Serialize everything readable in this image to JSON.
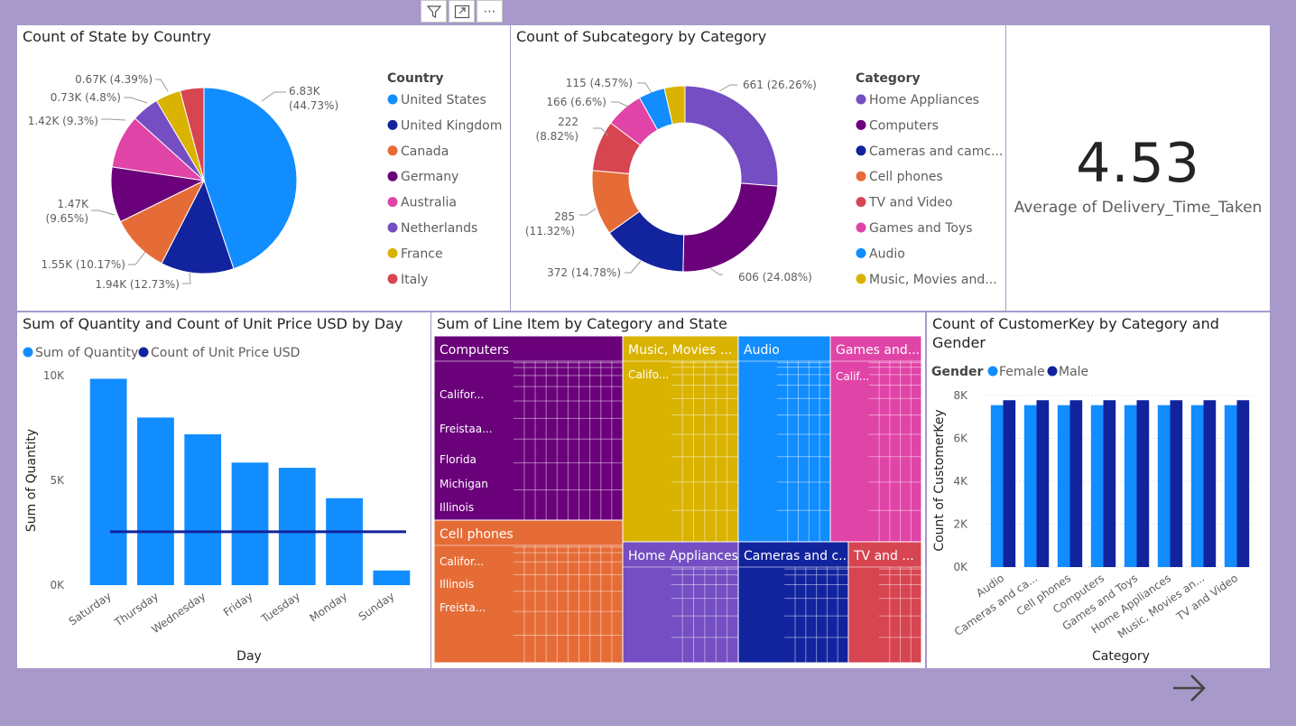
{
  "toolbar": {
    "icons": [
      "filter-icon",
      "focus-mode-icon",
      "more-options-icon"
    ],
    "more_label": "⋯"
  },
  "pie_country": {
    "title": "Count of State by Country",
    "legend_title": "Country",
    "chart_data": {
      "type": "pie",
      "title": "Count of State by Country",
      "slices": [
        {
          "label": "United States",
          "value": 6830,
          "display": "6.83K",
          "pct": "44.73%",
          "color": "#118dff"
        },
        {
          "label": "United Kingdom",
          "value": 1940,
          "display": "1.94K",
          "pct": "12.73%",
          "color": "#12239e"
        },
        {
          "label": "Canada",
          "value": 1550,
          "display": "1.55K",
          "pct": "10.17%",
          "color": "#e66c37"
        },
        {
          "label": "Germany",
          "value": 1470,
          "display": "1.47K",
          "pct": "9.65%",
          "color": "#6b007b"
        },
        {
          "label": "Australia",
          "value": 1420,
          "display": "1.42K",
          "pct": "9.3%",
          "color": "#e044a7"
        },
        {
          "label": "Netherlands",
          "value": 730,
          "display": "0.73K",
          "pct": "4.8%",
          "color": "#744ec2"
        },
        {
          "label": "France",
          "value": 670,
          "display": "0.67K",
          "pct": "4.39%",
          "color": "#d9b300"
        },
        {
          "label": "Italy",
          "value": 630,
          "display": "",
          "pct": "",
          "color": "#d64550"
        }
      ]
    }
  },
  "donut_category": {
    "title": "Count of Subcategory by Category",
    "legend_title": "Category",
    "chart_data": {
      "type": "pie",
      "title": "Count of Subcategory by Category",
      "slices": [
        {
          "label": "Home Appliances",
          "value": 661,
          "display": "661",
          "pct": "26.26%",
          "color": "#744ec2"
        },
        {
          "label": "Computers",
          "value": 606,
          "display": "606",
          "pct": "24.08%",
          "color": "#6b007b"
        },
        {
          "label": "Cameras and camc...",
          "value": 372,
          "display": "372",
          "pct": "14.78%",
          "color": "#12239e"
        },
        {
          "label": "Cell phones",
          "value": 285,
          "display": "285",
          "pct": "11.32%",
          "color": "#e66c37"
        },
        {
          "label": "TV and Video",
          "value": 222,
          "display": "222",
          "pct": "8.82%",
          "color": "#d64550"
        },
        {
          "label": "Games and Toys",
          "value": 166,
          "display": "166",
          "pct": "6.6%",
          "color": "#e044a7"
        },
        {
          "label": "Audio",
          "value": 115,
          "display": "115",
          "pct": "4.57%",
          "color": "#118dff"
        },
        {
          "label": "Music, Movies and...",
          "value": 90,
          "display": "",
          "pct": "",
          "color": "#d9b300"
        }
      ]
    }
  },
  "card": {
    "value": "4.53",
    "label": "Average of Delivery_Time_Taken"
  },
  "bar_day": {
    "title": "Sum of Quantity and Count of Unit Price USD by Day",
    "legend": [
      "Sum of Quantity",
      "Count of Unit Price USD"
    ],
    "chart_data": {
      "type": "bar",
      "title": "Sum of Quantity and Count of Unit Price USD by Day",
      "categories": [
        "Saturday",
        "Thursday",
        "Wednesday",
        "Friday",
        "Tuesday",
        "Monday",
        "Sunday"
      ],
      "series": [
        {
          "name": "Sum of Quantity",
          "values": [
            9850,
            8000,
            7200,
            5850,
            5600,
            4150,
            700
          ],
          "color": "#118dff"
        },
        {
          "name": "Count of Unit Price USD",
          "values": [
            2550,
            2550,
            2550,
            2550,
            2550,
            2550,
            2550
          ],
          "color": "#12239e"
        }
      ],
      "xlabel": "Day",
      "ylabel": "Sum of Quantity",
      "ylim": [
        0,
        10000
      ],
      "yticks": [
        "0K",
        "5K",
        "10K"
      ]
    }
  },
  "treemap": {
    "title": "Sum of Line Item by Category and State",
    "chart_data": {
      "type": "treemap",
      "title": "Sum of Line Item by Category and State",
      "groups": [
        {
          "name": "Computers",
          "states": [
            "Califor...",
            "Freistaa...",
            "Florida",
            "Michigan",
            "Illinois"
          ],
          "color": "#6b007b"
        },
        {
          "name": "Music, Movies ...",
          "states": [
            "Califo..."
          ],
          "color": "#d9b300"
        },
        {
          "name": "Audio",
          "states": [],
          "color": "#118dff"
        },
        {
          "name": "Games and...",
          "states": [
            "Calif..."
          ],
          "color": "#e044a7"
        },
        {
          "name": "Cell phones",
          "states": [
            "Califor...",
            "Illinois",
            "Freista..."
          ],
          "color": "#e66c37"
        },
        {
          "name": "Home Appliances",
          "states": [],
          "color": "#744ec2"
        },
        {
          "name": "Cameras and c...",
          "states": [],
          "color": "#12239e"
        },
        {
          "name": "TV and ...",
          "states": [],
          "color": "#d64550"
        }
      ]
    }
  },
  "clustered": {
    "title_line1": "Count of CustomerKey by Category and",
    "title_line2": "Gender",
    "legend_title": "Gender",
    "legend": [
      "Female",
      "Male"
    ],
    "chart_data": {
      "type": "bar",
      "title": "Count of CustomerKey by Category and Gender",
      "categories": [
        "Audio",
        "Cameras and ca...",
        "Cell phones",
        "Computers",
        "Games and Toys",
        "Home Appliances",
        "Music, Movies an...",
        "TV and Video"
      ],
      "series": [
        {
          "name": "Female",
          "values": [
            7550,
            7550,
            7550,
            7550,
            7550,
            7550,
            7550,
            7550
          ],
          "color": "#118dff"
        },
        {
          "name": "Male",
          "values": [
            7780,
            7780,
            7780,
            7780,
            7780,
            7780,
            7780,
            7780
          ],
          "color": "#12239e"
        }
      ],
      "xlabel": "Category",
      "ylabel": "Count of CustomerKey",
      "ylim": [
        0,
        8000
      ],
      "yticks": [
        "0K",
        "2K",
        "4K",
        "6K",
        "8K"
      ]
    }
  },
  "nav": {
    "next_icon": "arrow-right-icon"
  }
}
